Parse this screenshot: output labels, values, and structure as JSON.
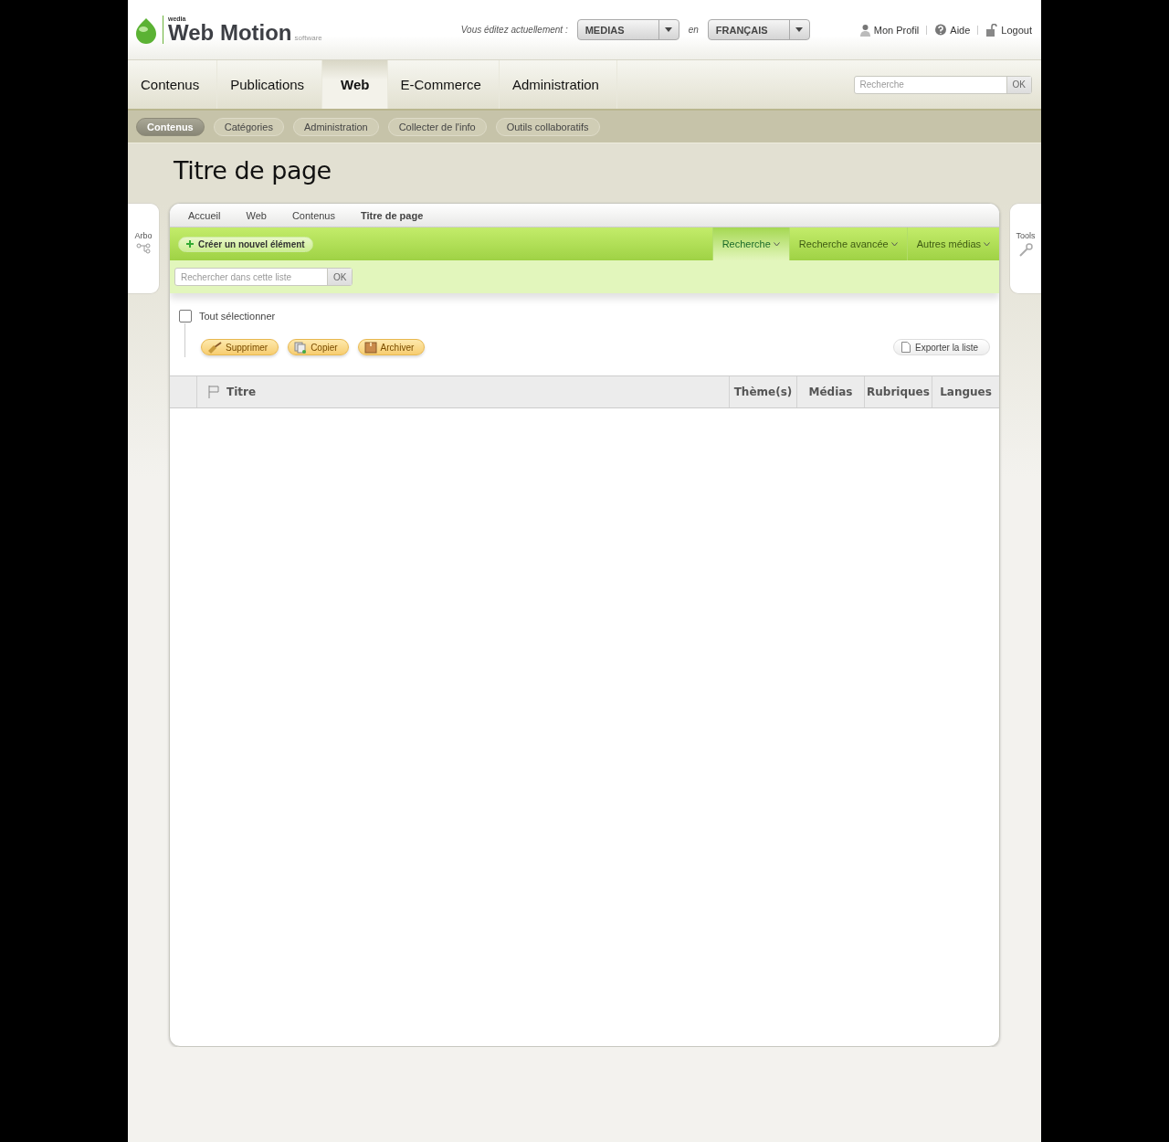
{
  "logo": {
    "brand": "wedia",
    "name": "Web Motion",
    "suffix": "software"
  },
  "editing": {
    "label": "Vous éditez actuellement :",
    "media": "MEDIAS",
    "joiner": "en",
    "language": "FRANÇAIS"
  },
  "user_links": [
    {
      "kind": "profile",
      "label": "Mon Profil"
    },
    {
      "kind": "help",
      "label": "Aide"
    },
    {
      "kind": "logout",
      "label": "Logout"
    }
  ],
  "main_nav": [
    {
      "label": "Contenus",
      "selected": false
    },
    {
      "label": "Publications",
      "selected": false
    },
    {
      "label": "Web",
      "selected": true
    },
    {
      "label": "E-Commerce",
      "selected": false
    },
    {
      "label": "Administration",
      "selected": false
    }
  ],
  "search": {
    "placeholder": "Recherche",
    "button": "OK"
  },
  "sub_nav": [
    {
      "label": "Contenus",
      "selected": true
    },
    {
      "label": "Catégories",
      "selected": false
    },
    {
      "label": "Administration",
      "selected": false
    },
    {
      "label": "Collecter de l'info",
      "selected": false
    },
    {
      "label": "Outils collaboratifs",
      "selected": false
    }
  ],
  "page_title": "Titre de page",
  "left_tab": {
    "label": "Arbo"
  },
  "right_tab": {
    "label": "Tools"
  },
  "breadcrumb": [
    {
      "label": "Accueil",
      "current": false
    },
    {
      "label": "Web",
      "current": false
    },
    {
      "label": "Contenus",
      "current": false
    },
    {
      "label": "Titre de page",
      "current": true
    }
  ],
  "create_button": "Créer un nouvel élément",
  "search_tabs": [
    {
      "label": "Recherche",
      "selected": true
    },
    {
      "label": "Recherche avancée",
      "selected": false
    },
    {
      "label": "Autres médias",
      "selected": false
    }
  ],
  "list_search": {
    "placeholder": "Rechercher dans cette liste",
    "button": "OK"
  },
  "select_all": {
    "label": "Tout sélectionner",
    "checked": false
  },
  "actions": [
    {
      "kind": "delete",
      "label": "Supprimer"
    },
    {
      "kind": "copy",
      "label": "Copier"
    },
    {
      "kind": "archive",
      "label": "Archiver"
    }
  ],
  "export_button": "Exporter la liste",
  "table": {
    "columns": [
      "Titre",
      "Thème(s)",
      "Médias",
      "Rubriques",
      "Langues"
    ]
  }
}
